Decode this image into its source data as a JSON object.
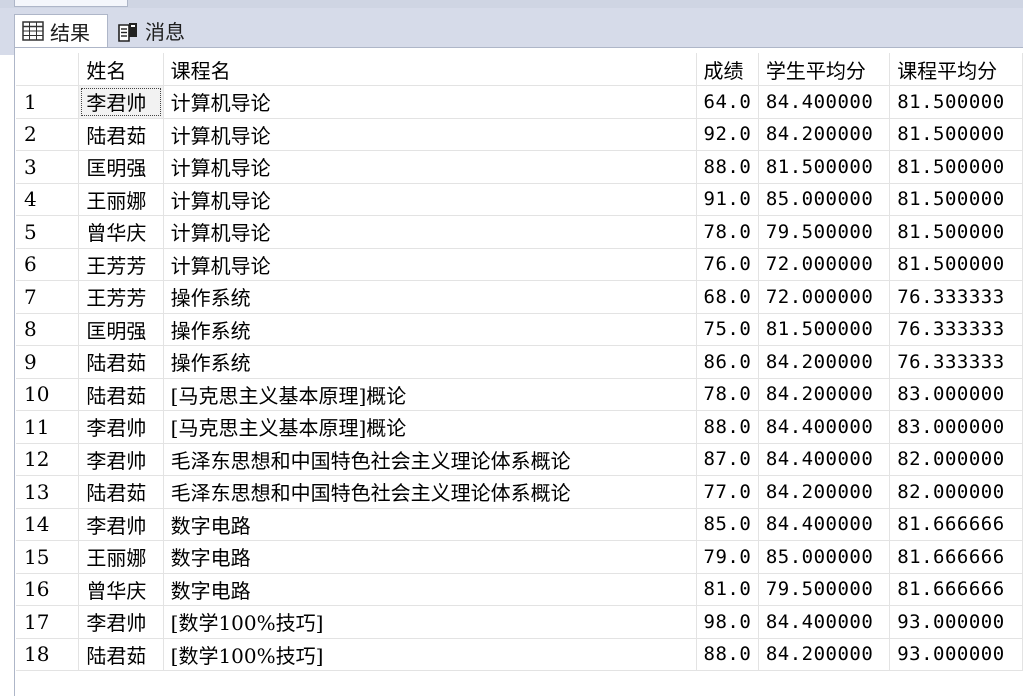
{
  "tabs": [
    {
      "label": "结果",
      "icon": "grid-icon",
      "active": true
    },
    {
      "label": "消息",
      "icon": "messages-icon",
      "active": false
    }
  ],
  "columns": [
    "姓名",
    "课程名",
    "成绩",
    "学生平均分",
    "课程平均分"
  ],
  "rows": [
    {
      "num": "1",
      "name": "李君帅",
      "course": "计算机导论",
      "score": "64.0",
      "student_avg": "84.400000",
      "course_avg": "81.500000"
    },
    {
      "num": "2",
      "name": "陆君茹",
      "course": "计算机导论",
      "score": "92.0",
      "student_avg": "84.200000",
      "course_avg": "81.500000"
    },
    {
      "num": "3",
      "name": "匡明强",
      "course": "计算机导论",
      "score": "88.0",
      "student_avg": "81.500000",
      "course_avg": "81.500000"
    },
    {
      "num": "4",
      "name": "王丽娜",
      "course": "计算机导论",
      "score": "91.0",
      "student_avg": "85.000000",
      "course_avg": "81.500000"
    },
    {
      "num": "5",
      "name": "曾华庆",
      "course": "计算机导论",
      "score": "78.0",
      "student_avg": "79.500000",
      "course_avg": "81.500000"
    },
    {
      "num": "6",
      "name": "王芳芳",
      "course": "计算机导论",
      "score": "76.0",
      "student_avg": "72.000000",
      "course_avg": "81.500000"
    },
    {
      "num": "7",
      "name": "王芳芳",
      "course": "操作系统",
      "score": "68.0",
      "student_avg": "72.000000",
      "course_avg": "76.333333"
    },
    {
      "num": "8",
      "name": "匡明强",
      "course": "操作系统",
      "score": "75.0",
      "student_avg": "81.500000",
      "course_avg": "76.333333"
    },
    {
      "num": "9",
      "name": "陆君茹",
      "course": "操作系统",
      "score": "86.0",
      "student_avg": "84.200000",
      "course_avg": "76.333333"
    },
    {
      "num": "10",
      "name": "陆君茹",
      "course": "[马克思主义基本原理]概论",
      "score": "78.0",
      "student_avg": "84.200000",
      "course_avg": "83.000000"
    },
    {
      "num": "11",
      "name": "李君帅",
      "course": "[马克思主义基本原理]概论",
      "score": "88.0",
      "student_avg": "84.400000",
      "course_avg": "83.000000"
    },
    {
      "num": "12",
      "name": "李君帅",
      "course": "毛泽东思想和中国特色社会主义理论体系概论",
      "score": "87.0",
      "student_avg": "84.400000",
      "course_avg": "82.000000"
    },
    {
      "num": "13",
      "name": "陆君茹",
      "course": "毛泽东思想和中国特色社会主义理论体系概论",
      "score": "77.0",
      "student_avg": "84.200000",
      "course_avg": "82.000000"
    },
    {
      "num": "14",
      "name": "李君帅",
      "course": "数字电路",
      "score": "85.0",
      "student_avg": "84.400000",
      "course_avg": "81.666666"
    },
    {
      "num": "15",
      "name": "王丽娜",
      "course": "数字电路",
      "score": "79.0",
      "student_avg": "85.000000",
      "course_avg": "81.666666"
    },
    {
      "num": "16",
      "name": "曾华庆",
      "course": "数字电路",
      "score": "81.0",
      "student_avg": "79.500000",
      "course_avg": "81.666666"
    },
    {
      "num": "17",
      "name": "李君帅",
      "course": "[数学100%技巧]",
      "score": "98.0",
      "student_avg": "84.400000",
      "course_avg": "93.000000"
    },
    {
      "num": "18",
      "name": "陆君茹",
      "course": "[数学100%技巧]",
      "score": "88.0",
      "student_avg": "84.200000",
      "course_avg": "93.000000"
    }
  ]
}
